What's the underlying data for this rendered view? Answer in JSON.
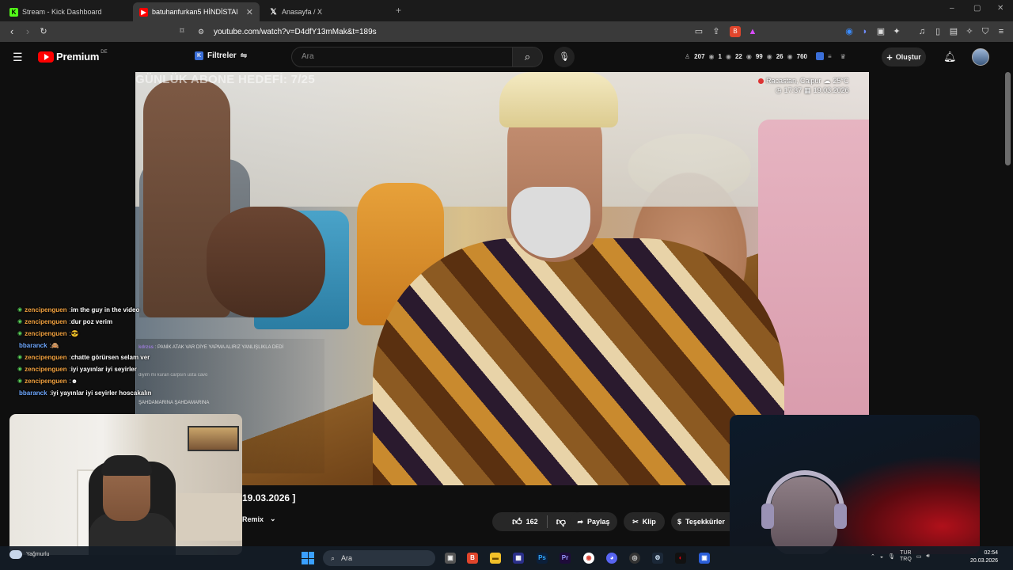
{
  "browser": {
    "tabs": [
      {
        "title": "Stream - Kick Dashboard",
        "icon": "kick-icon",
        "active": false
      },
      {
        "title": "batuhanfurkan5 HİNDİSTAN ( ",
        "icon": "youtube-icon",
        "active": true
      },
      {
        "title": "Anasayfa / X",
        "icon": "x-icon",
        "active": false
      }
    ],
    "new_tab": "+",
    "url": "youtube.com/watch?v=D4dfY13mMak&t=189s",
    "window_controls": {
      "minimize": "–",
      "maximize": "▢",
      "close": "✕"
    }
  },
  "youtube": {
    "logo_text": "Premium",
    "region": "DE",
    "filters_label": "Filtreler",
    "search_placeholder": "Ara",
    "stats": [
      {
        "icon": "viewer-icon",
        "value": "207"
      },
      {
        "icon": "eye-icon",
        "value": "1"
      },
      {
        "icon": "eye-icon",
        "value": "22"
      },
      {
        "icon": "eye-icon",
        "value": "99"
      },
      {
        "icon": "eye-icon",
        "value": "26"
      },
      {
        "icon": "eye-icon",
        "value": "760"
      }
    ],
    "create_label": "Oluştur"
  },
  "video": {
    "overlay_title": "GÜNLÜK ABONE HEDEFİ: 7/25",
    "location": "Racastan, Caipur",
    "weather": "25°C",
    "time": "17:37",
    "date": "19.03.2026"
  },
  "chat": [
    {
      "user": "zencipenguen",
      "color": "#f4a340",
      "bullet": true,
      "msg": "im the guy in the video"
    },
    {
      "user": "zencipenguen",
      "color": "#f4a340",
      "bullet": true,
      "msg": "dur poz verim"
    },
    {
      "user": "zencipenguen",
      "color": "#f4a340",
      "bullet": true,
      "msg": "😎"
    },
    {
      "user": "bbaranck",
      "color": "#6fa8ff",
      "bullet": false,
      "msg": "🙈"
    },
    {
      "user": "zencipenguen",
      "color": "#f4a340",
      "bullet": true,
      "msg": "chatte görürsen selam ver"
    },
    {
      "user": "zencipenguen",
      "color": "#f4a340",
      "bullet": true,
      "msg": "iyi yayınlar iyi seyirler"
    },
    {
      "user": "zencipenguen",
      "color": "#f4a340",
      "bullet": true,
      "msg": "☻"
    },
    {
      "user": "bbaranck",
      "color": "#6fa8ff",
      "bullet": false,
      "msg": "iyi yayınlar iyi seyirler hoscakalın"
    }
  ],
  "yt_chat": [
    {
      "name": "kdrzss",
      "msg": "PANİK ATAK VAR DİYE YAPMA ALIRIZ YANLIŞLIKLA DEDİ"
    },
    {
      "name": "",
      "msg": "diyim mi kuran carpsın usta cavo"
    },
    {
      "name": "",
      "msg": "ŞAHDAMARINA ŞAHDAMARINA"
    }
  ],
  "below_video": {
    "date_caption": "19.03.2026 ]",
    "remix_label": "Remix",
    "like_count": "162",
    "share_label": "Paylaş",
    "clip_label": "Klip",
    "thanks_label": "Teşekkürler"
  },
  "taskbar": {
    "weather_label": "Yağmurlu",
    "search_label": "Ara",
    "lang_top": "TUR",
    "lang_bottom": "TRQ",
    "time": "02:54",
    "date": "20.03.2026"
  }
}
